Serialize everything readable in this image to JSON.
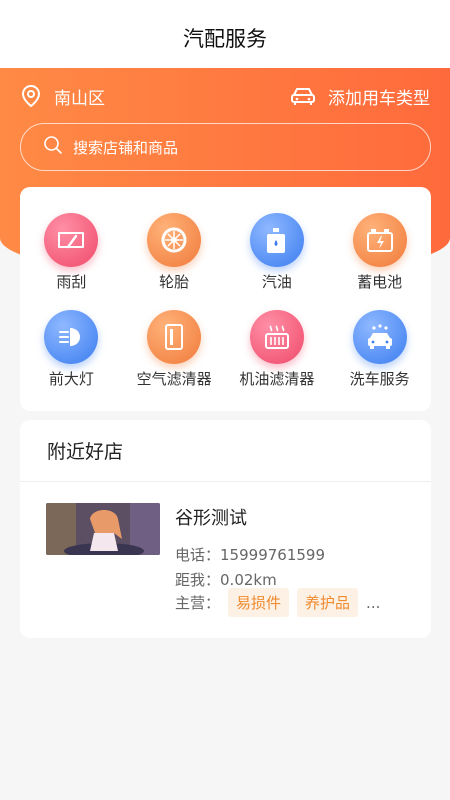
{
  "nav": {
    "title": "汽配服务"
  },
  "location": {
    "district": "南山区",
    "add_vehicle": "添加用车类型"
  },
  "search": {
    "placeholder": "搜索店铺和商品"
  },
  "categories": [
    {
      "label": "雨刮",
      "icon": "wiper-icon",
      "color": "pink"
    },
    {
      "label": "轮胎",
      "icon": "tire-icon",
      "color": "orange"
    },
    {
      "label": "汽油",
      "icon": "oil-can-icon",
      "color": "blue"
    },
    {
      "label": "蓄电池",
      "icon": "battery-icon",
      "color": "orange"
    },
    {
      "label": "前大灯",
      "icon": "headlight-icon",
      "color": "blue"
    },
    {
      "label": "空气滤清器",
      "icon": "air-filter-icon",
      "color": "orange"
    },
    {
      "label": "机油滤清器",
      "icon": "oil-filter-icon",
      "color": "pink"
    },
    {
      "label": "洗车服务",
      "icon": "car-wash-icon",
      "color": "blue"
    }
  ],
  "nearby": {
    "title": "附近好店",
    "shop": {
      "name": "谷形测试",
      "phone_label": "电话：",
      "phone": "15999761599",
      "distance_label": "距我：",
      "distance": "0.02km",
      "main_label": "主营：",
      "tags": [
        "易损件",
        "养护品"
      ],
      "more": "..."
    }
  },
  "colors": {
    "accent": "#ff7a40",
    "tag_text": "#f08a2e",
    "tag_bg": "#fdf0e4"
  }
}
